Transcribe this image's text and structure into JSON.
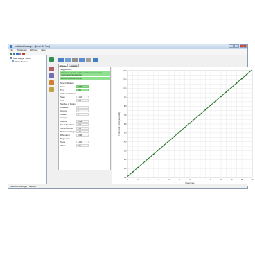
{
  "window": {
    "title": "InSituLab Manager - [Level 4H Tool]",
    "buttons": {
      "minimize": "–",
      "maximize": "□",
      "close": "✕"
    }
  },
  "menu": [
    "File",
    "Workspace",
    "Window",
    "Help"
  ],
  "tree": {
    "root": "Data Logger Server",
    "child": "Probe Server"
  },
  "tabs": [
    "Points",
    "Graphs"
  ],
  "panel": {
    "header": "Suggestions",
    "messages": [
      "Calibration equation requires revision (due to sensors response) to calculate slope.",
      "Recommended fail change"
    ],
    "sections": [
      {
        "label": "New Calibration",
        "rows": [
          {
            "label": "Span",
            "value": "0.996",
            "style": "green"
          },
          {
            "label": "Trim",
            "value": "0.11",
            "style": "green"
          }
        ]
      },
      {
        "label": "Active Calibration",
        "rows": [
          {
            "label": "Span",
            "value": "1.000",
            "style": "plain"
          },
          {
            "label": "Trim",
            "value": "0.00",
            "style": "plain"
          }
        ]
      },
      {
        "label": "Number of Points",
        "rows": [
          {
            "label": "Indicated",
            "value": "0",
            "style": "plain"
          },
          {
            "label": "Ignored",
            "value": "0",
            "style": "plain"
          },
          {
            "label": "Outliers",
            "value": "0",
            "style": "plain"
          }
        ]
      },
      {
        "label": "Analysis",
        "rows": [
          {
            "label": "Method",
            "value": "Offset",
            "style": "plain"
          },
          {
            "label": "SD of Residuals",
            "value": "0.00",
            "style": "plain"
          },
          {
            "label": "Sensor Range",
            "value": "1.00",
            "style": "plain"
          },
          {
            "label": "Reference Range",
            "value": "1.11",
            "style": "plain"
          },
          {
            "label": "R Squared",
            "value": "0.998",
            "style": "plain"
          }
        ]
      },
      {
        "label": "Regression",
        "rows": [
          {
            "label": "Slope",
            "value": "1.000",
            "style": "plain"
          },
          {
            "label": "Offset",
            "value": "0.11",
            "style": "plain"
          }
        ]
      }
    ]
  },
  "status": "InSituLab Manager - READY",
  "chart_data": {
    "type": "scatter",
    "xlabel": "Reference",
    "ylabel": "Instrument - Unit (adjusted)",
    "xlim": [
      0,
      12
    ],
    "ylim": [
      0,
      12
    ],
    "xticks": [
      "0",
      "1",
      "2",
      "3",
      "4",
      "5",
      "6",
      "7",
      "8",
      "9",
      "10",
      "11",
      "12"
    ],
    "yticks": [
      "0.0",
      "1.0",
      "2.0",
      "3.0",
      "4.0",
      "5.0",
      "6.0",
      "7.0",
      "8.0",
      "9.0",
      "10.0",
      "11.0",
      "12.0"
    ],
    "grid": true,
    "line": {
      "x": [
        0,
        12
      ],
      "y": [
        0.11,
        12.11
      ]
    },
    "series": [
      {
        "x": [
          0.5,
          1,
          1.5,
          2,
          2.5,
          3,
          3.5,
          4,
          4.5,
          5,
          5.5,
          6,
          6.5,
          7,
          7.5,
          8,
          8.5,
          9,
          9.5,
          10,
          10.5,
          11,
          11.3,
          11.5
        ],
        "y": [
          0.6,
          1.1,
          1.6,
          2.1,
          2.6,
          3.1,
          3.6,
          4.1,
          4.6,
          5.1,
          5.6,
          6.1,
          6.6,
          7.1,
          7.6,
          8.1,
          8.6,
          9.1,
          9.6,
          10.1,
          10.6,
          11.1,
          11.4,
          11.6
        ]
      }
    ],
    "colors": {
      "line": "#2f7d2f",
      "points": "#1f5f1f",
      "grid": "#d6d6d6"
    }
  }
}
